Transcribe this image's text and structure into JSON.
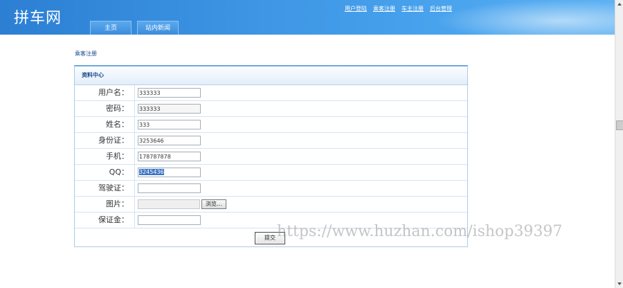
{
  "header": {
    "logo": "拼车网",
    "top_links": [
      "用户登陆",
      "乘客注册",
      "车主注册",
      "后台管理"
    ],
    "nav_tabs": [
      "主页",
      "站内新闻"
    ]
  },
  "breadcrumb": "乘客注册",
  "panel": {
    "title": "资料中心",
    "fields": {
      "username": {
        "label": "用户名：",
        "value": "333333"
      },
      "password": {
        "label": "密码：",
        "value": "333333"
      },
      "name": {
        "label": "姓名：",
        "value": "333"
      },
      "id_card": {
        "label": "身份证：",
        "value": "3253646"
      },
      "phone": {
        "label": "手机：",
        "value": "178787878"
      },
      "qq": {
        "label": "QQ：",
        "value": "3245436"
      },
      "license": {
        "label": "驾驶证：",
        "value": ""
      },
      "photo": {
        "label": "图片：",
        "browse_label": "浏览..."
      },
      "deposit": {
        "label": "保证金：",
        "value": ""
      }
    },
    "submit_label": "提交"
  },
  "watermark": "https://www.huzhan.com/ishop39397"
}
